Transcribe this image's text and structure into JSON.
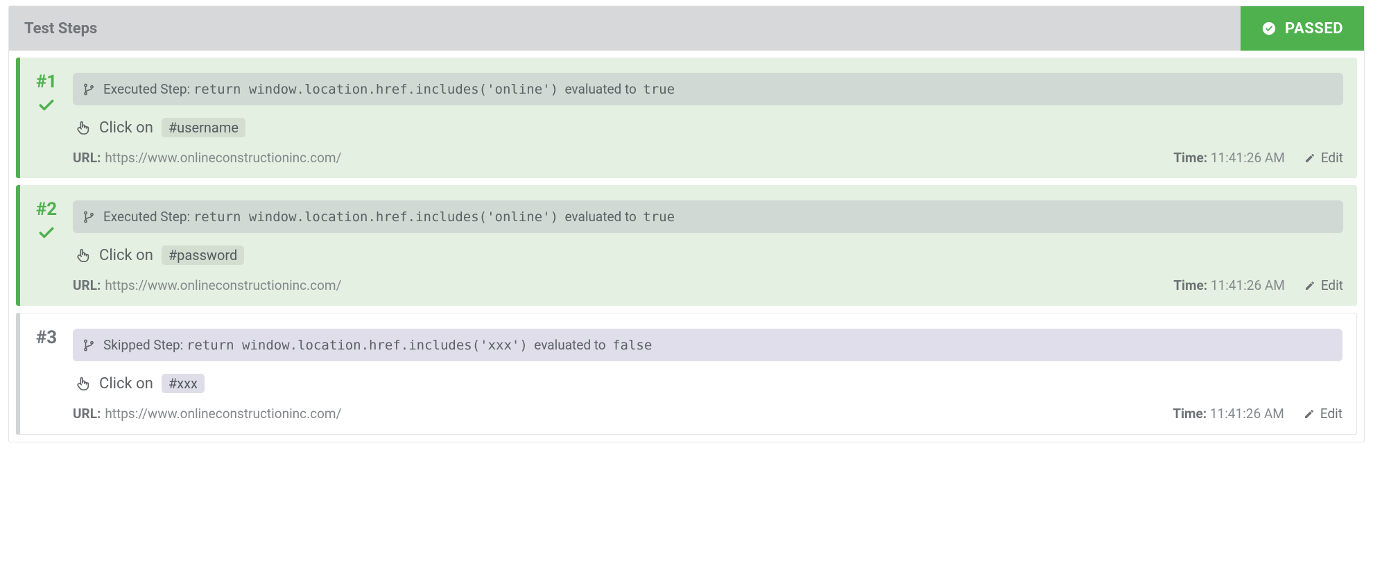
{
  "header": {
    "title": "Test Steps",
    "status": "PASSED"
  },
  "labels": {
    "executed_prefix": "Executed Step:",
    "skipped_prefix": "Skipped Step:",
    "evaluated_to": "evaluated to",
    "click_on": "Click on",
    "url_label": "URL:",
    "time_label": "Time:",
    "edit": "Edit"
  },
  "steps": [
    {
      "number": "#1",
      "kind": "passed",
      "eval_code": "return window.location.href.includes('online')",
      "eval_result": "true",
      "selector": "#username",
      "url": "https://www.onlineconstructioninc.com/",
      "time": "11:41:26 AM"
    },
    {
      "number": "#2",
      "kind": "passed",
      "eval_code": "return window.location.href.includes('online')",
      "eval_result": "true",
      "selector": "#password",
      "url": "https://www.onlineconstructioninc.com/",
      "time": "11:41:26 AM"
    },
    {
      "number": "#3",
      "kind": "skipped",
      "eval_code": "return window.location.href.includes('xxx')",
      "eval_result": "false",
      "selector": "#xxx",
      "url": "https://www.onlineconstructioninc.com/",
      "time": "11:41:26 AM"
    }
  ]
}
